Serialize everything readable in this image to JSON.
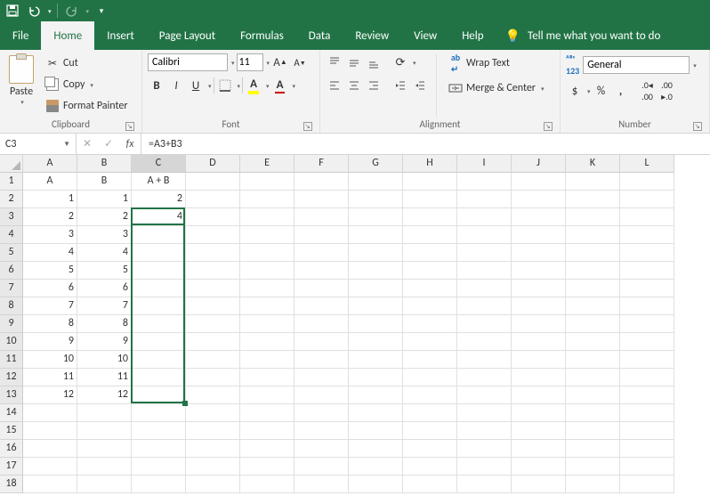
{
  "qat": {
    "save": "save-icon",
    "undo": "undo-icon",
    "redo": "redo-icon"
  },
  "tabs": [
    "File",
    "Home",
    "Insert",
    "Page Layout",
    "Formulas",
    "Data",
    "Review",
    "View",
    "Help"
  ],
  "active_tab": "Home",
  "tell_me": "Tell me what you want to do",
  "ribbon": {
    "clipboard": {
      "paste": "Paste",
      "cut": "Cut",
      "copy": "Copy",
      "format_painter": "Format Painter",
      "label": "Clipboard"
    },
    "font": {
      "name": "Calibri",
      "size": "11",
      "increase": "A",
      "decrease": "A",
      "bold": "B",
      "italic": "I",
      "underline": "U",
      "label": "Font"
    },
    "alignment": {
      "wrap": "Wrap Text",
      "merge": "Merge & Center",
      "label": "Alignment"
    },
    "number": {
      "format": "General",
      "label": "Number",
      "abc123": "ᴬᴮᶜ"
    }
  },
  "formula_bar": {
    "namebox": "C3",
    "formula": "=A3+B3",
    "fx": "fx"
  },
  "columns": [
    "A",
    "B",
    "C",
    "D",
    "E",
    "F",
    "G",
    "H",
    "I",
    "J",
    "K",
    "L"
  ],
  "row_count": 18,
  "cells": {
    "header": {
      "A": "A",
      "B": "B",
      "C": "A + B"
    },
    "data": [
      {
        "A": "1",
        "B": "1",
        "C": "2"
      },
      {
        "A": "2",
        "B": "2",
        "C": "4"
      },
      {
        "A": "3",
        "B": "3",
        "C": ""
      },
      {
        "A": "4",
        "B": "4",
        "C": ""
      },
      {
        "A": "5",
        "B": "5",
        "C": ""
      },
      {
        "A": "6",
        "B": "6",
        "C": ""
      },
      {
        "A": "7",
        "B": "7",
        "C": ""
      },
      {
        "A": "8",
        "B": "8",
        "C": ""
      },
      {
        "A": "9",
        "B": "9",
        "C": ""
      },
      {
        "A": "10",
        "B": "10",
        "C": ""
      },
      {
        "A": "11",
        "B": "11",
        "C": ""
      },
      {
        "A": "12",
        "B": "12",
        "C": ""
      }
    ]
  },
  "selection": {
    "active": "C3",
    "range_start_row": 3,
    "range_end_row": 13,
    "col": "C"
  }
}
